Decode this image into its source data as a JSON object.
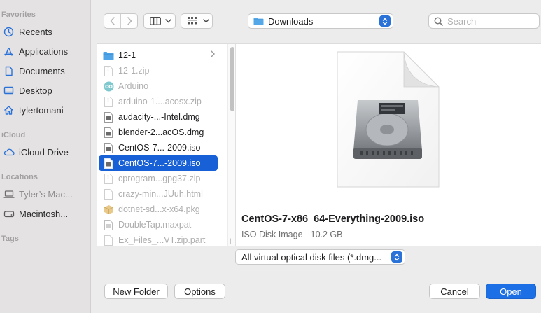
{
  "sidebar": {
    "sections": {
      "favorites": "Favorites",
      "icloud": "iCloud",
      "locations": "Locations",
      "tags": "Tags"
    },
    "favorites": [
      {
        "label": "Recents",
        "icon": "clock-icon"
      },
      {
        "label": "Applications",
        "icon": "applications-icon"
      },
      {
        "label": "Documents",
        "icon": "document-icon"
      },
      {
        "label": "Desktop",
        "icon": "desktop-icon"
      },
      {
        "label": "tylertomani",
        "icon": "home-icon"
      }
    ],
    "icloud": [
      {
        "label": "iCloud Drive",
        "icon": "cloud-icon"
      }
    ],
    "locations": [
      {
        "label": "Tyler’s Mac...",
        "icon": "laptop-icon"
      },
      {
        "label": "Macintosh...",
        "icon": "disk-icon"
      }
    ]
  },
  "toolbar": {
    "location": "Downloads",
    "search_placeholder": "Search"
  },
  "files": [
    {
      "name": "12-1",
      "kind": "folder",
      "dim": false,
      "selected": false
    },
    {
      "name": "12-1.zip",
      "kind": "doc",
      "dim": true,
      "selected": false
    },
    {
      "name": "Arduino",
      "kind": "app",
      "dim": true,
      "selected": false
    },
    {
      "name": "arduino-1....acosx.zip",
      "kind": "doc",
      "dim": true,
      "selected": false
    },
    {
      "name": "audacity-...-Intel.dmg",
      "kind": "dmg",
      "dim": false,
      "selected": false
    },
    {
      "name": "blender-2...acOS.dmg",
      "kind": "dmg",
      "dim": false,
      "selected": false
    },
    {
      "name": "CentOS-7...-2009.iso",
      "kind": "dmg",
      "dim": false,
      "selected": false
    },
    {
      "name": "CentOS-7...-2009.iso",
      "kind": "dmg",
      "dim": false,
      "selected": true
    },
    {
      "name": "cprogram...gpg37.zip",
      "kind": "doc",
      "dim": true,
      "selected": false
    },
    {
      "name": "crazy-min...JUuh.html",
      "kind": "doc",
      "dim": true,
      "selected": false
    },
    {
      "name": "dotnet-sd...x-x64.pkg",
      "kind": "pkg",
      "dim": true,
      "selected": false
    },
    {
      "name": "DoubleTap.maxpat",
      "kind": "doc",
      "dim": true,
      "selected": false
    },
    {
      "name": "Ex_Files_...VT.zip.part",
      "kind": "doc",
      "dim": true,
      "selected": false
    }
  ],
  "preview": {
    "name": "CentOS-7-x86_64-Everything-2009.iso",
    "kind": "ISO Disk Image - 10.2 GB"
  },
  "filter": {
    "label": "All virtual optical disk files (*.dmg..."
  },
  "buttons": {
    "new_folder": "New Folder",
    "options": "Options",
    "cancel": "Cancel",
    "open": "Open"
  },
  "colors": {
    "accent": "#1c6fe4",
    "selection": "#1860d6",
    "sidebar_bg": "#e4e2e3",
    "icon_blue": "#2a72d8"
  }
}
